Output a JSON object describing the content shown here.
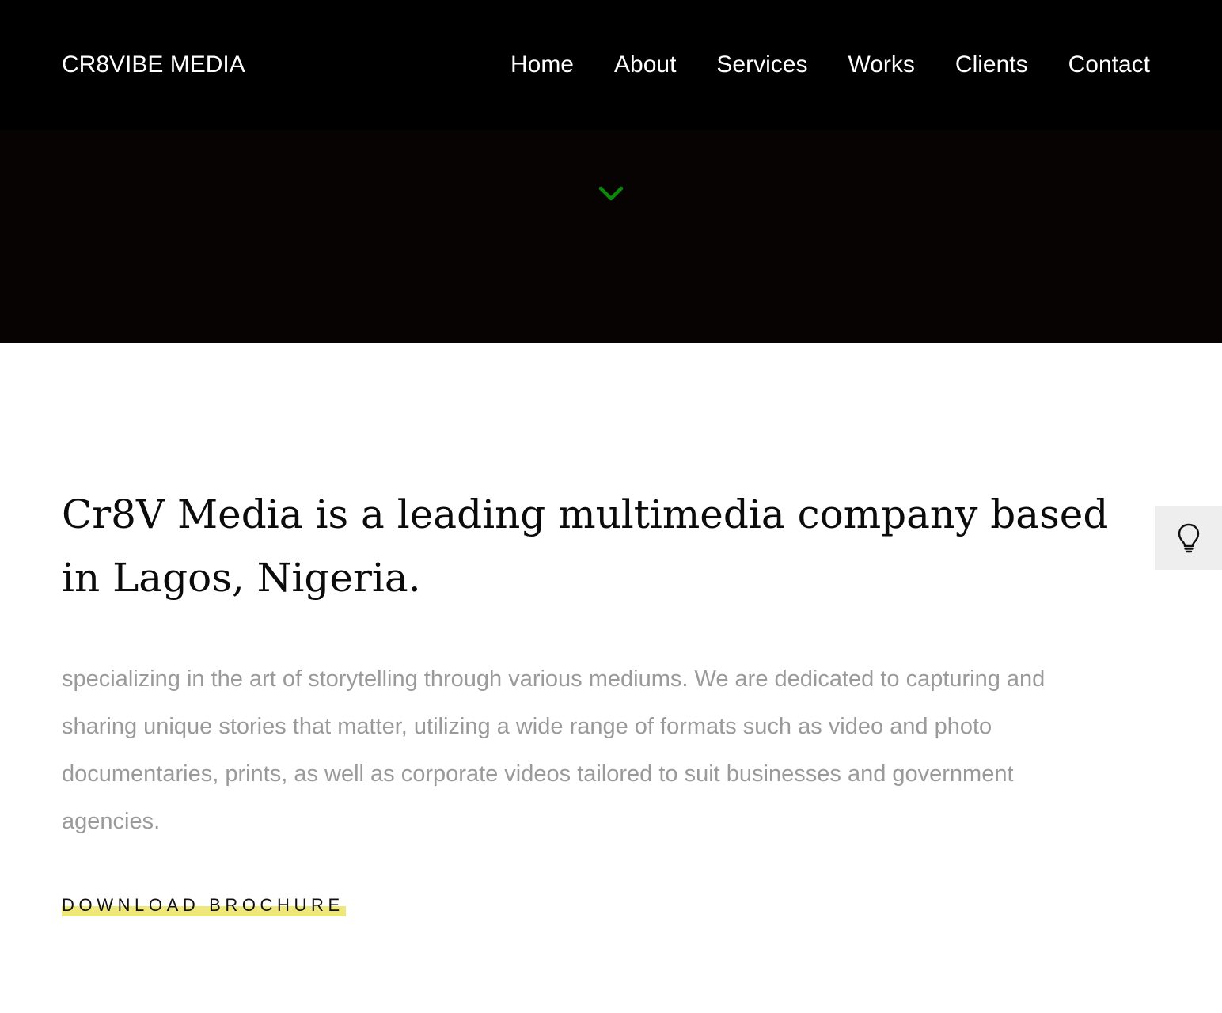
{
  "header": {
    "brand": "CR8VIBE MEDIA",
    "nav": [
      "Home",
      "About",
      "Services",
      "Works",
      "Clients",
      "Contact"
    ]
  },
  "hero": {
    "scroll_icon": "chevron-down-icon",
    "scroll_icon_color": "#0a8a0a"
  },
  "about": {
    "headline": "Cr8V Media is a leading multimedia company based in Lagos, Nigeria.",
    "body": "specializing in the art of storytelling through various mediums. We are dedicated to capturing and sharing unique stories that matter, utilizing a wide range of formats such as video and photo documentaries, prints, as well as corporate videos tailored to suit businesses and government agencies.",
    "cta_label": "DOWNLOAD BROCHURE",
    "cta_highlight_color": "#eee77a"
  },
  "side_toggle": {
    "icon": "lightbulb-icon"
  }
}
